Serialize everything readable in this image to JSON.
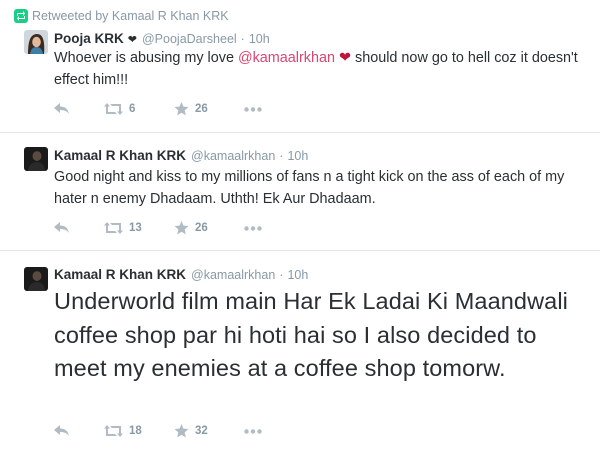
{
  "tweets": [
    {
      "retweet_context": "Retweeted by Kamaal R Khan KRK",
      "fullname": "Pooja KRK",
      "name_suffix": "❤",
      "username": "@PoojaDarsheel",
      "separator": "·",
      "time": "10h",
      "text_parts": {
        "before": "Whoever is abusing my love ",
        "mention": "@kamaalrkhan",
        "heart": "❤",
        "after": " should now go to hell coz it doesn't effect him!!!"
      },
      "retweets": "6",
      "favorites": "26",
      "avatar_icon": "avatar-woman"
    },
    {
      "fullname": "Kamaal R Khan KRK",
      "username": "@kamaalrkhan",
      "separator": "·",
      "time": "10h",
      "text": "Good night and kiss to my millions of fans n a tight kick on the ass of each of my hater n enemy Dhadaam. Uthth! Ek Aur Dhadaam.",
      "retweets": "13",
      "favorites": "26",
      "avatar_icon": "avatar-man"
    },
    {
      "fullname": "Kamaal R Khan KRK",
      "username": "@kamaalrkhan",
      "separator": "·",
      "time": "10h",
      "text": "Underworld film main Har Ek Ladai Ki Maandwali coffee shop par hi hoti hai so I also decided to meet my enemies at a coffee shop tomorw.",
      "retweets": "18",
      "favorites": "32",
      "avatar_icon": "avatar-man"
    }
  ],
  "icons": {
    "reply": "reply-icon",
    "retweet": "retweet-icon",
    "favorite": "star-icon",
    "more": "more-icon",
    "retweet_context": "retweet-context-icon"
  },
  "colors": {
    "mention": "#d9466f",
    "heart": "#c0143c",
    "meta_text": "#8899a6",
    "action_icon": "#b1bbc3",
    "retweet_green": "#19cf86",
    "divider": "#e1e8ed"
  }
}
